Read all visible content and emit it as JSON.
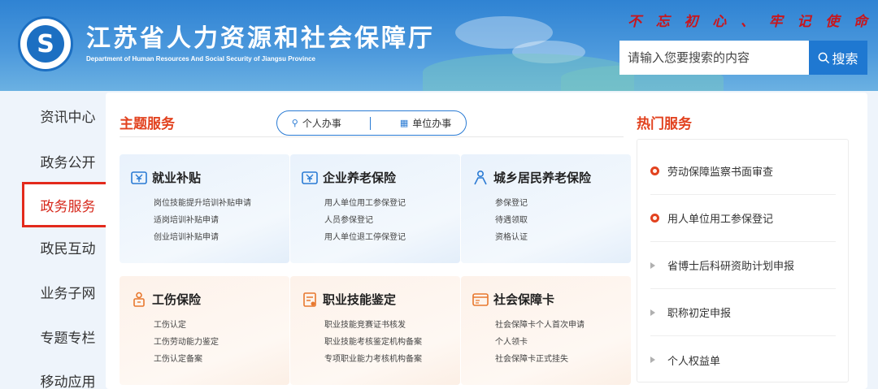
{
  "header": {
    "title": "江苏省人力资源和社会保障厅",
    "subtitle": "Department of Human Resources And Social Security of Jiangsu Province",
    "slogan": [
      "不",
      "忘",
      "初",
      "心",
      "、",
      "牢",
      "记",
      "使",
      "命"
    ],
    "search_placeholder": "请输入您要搜索的内容",
    "search_button": "搜索"
  },
  "left_nav": [
    {
      "label": "资讯中心",
      "active": false
    },
    {
      "label": "政务公开",
      "active": false
    },
    {
      "label": "政务服务",
      "active": true
    },
    {
      "label": "政民互动",
      "active": false
    },
    {
      "label": "业务子网",
      "active": false
    },
    {
      "label": "专题专栏",
      "active": false
    },
    {
      "label": "移动应用",
      "active": false
    }
  ],
  "theme": {
    "title": "主题服务",
    "toggle": [
      "个人办事",
      "单位办事"
    ],
    "tiles": [
      {
        "title": "就业补贴",
        "icon": "money-icon",
        "color": "blue",
        "links": [
          "岗位技能提升培训补贴申请",
          "适岗培训补贴申请",
          "创业培训补贴申请"
        ]
      },
      {
        "title": "企业养老保险",
        "icon": "money-icon",
        "color": "blue",
        "links": [
          "用人单位用工参保登记",
          "人员参保登记",
          "用人单位退工停保登记"
        ]
      },
      {
        "title": "城乡居民养老保险",
        "icon": "elder-icon",
        "color": "blue",
        "links": [
          "参保登记",
          "待遇领取",
          "资格认证"
        ]
      },
      {
        "title": "工伤保险",
        "icon": "worker-icon",
        "color": "orange",
        "links": [
          "工伤认定",
          "工伤劳动能力鉴定",
          "工伤认定备案"
        ]
      },
      {
        "title": "职业技能鉴定",
        "icon": "certificate-icon",
        "color": "orange",
        "links": [
          "职业技能竞赛证书核发",
          "职业技能考核鉴定机构备案",
          "专项职业能力考核机构备案"
        ]
      },
      {
        "title": "社会保障卡",
        "icon": "card-icon",
        "color": "orange",
        "links": [
          "社会保障卡个人首次申请",
          "个人领卡",
          "社会保障卡正式挂失"
        ]
      }
    ]
  },
  "hot": {
    "title": "热门服务",
    "items": [
      {
        "label": "劳动保障监察书面审查",
        "hot": true
      },
      {
        "label": "用人单位用工参保登记",
        "hot": true
      },
      {
        "label": "省博士后科研资助计划申报",
        "hot": false
      },
      {
        "label": "职称初定申报",
        "hot": false
      },
      {
        "label": "个人权益单",
        "hot": false
      }
    ]
  },
  "colors": {
    "accent": "#e2421f",
    "brand_blue": "#1f78d1",
    "active_border": "#e32a1c"
  }
}
